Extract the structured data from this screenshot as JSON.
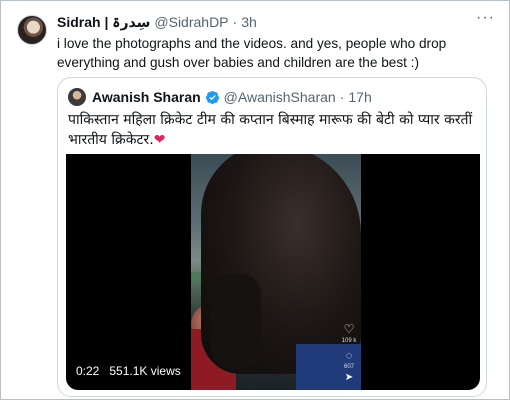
{
  "tweet": {
    "name": "Sidrah | سِدرۃ",
    "handle": "@SidrahDP",
    "time": "3h",
    "more_label": "···",
    "text": "i love the photographs and the videos. and yes, people who drop everything and gush over babies and children are the best :)"
  },
  "quote": {
    "name": "Awanish Sharan",
    "handle": "@AwanishSharan",
    "time": "17h",
    "text": "पाकिस्तान महिला क्रिकेट टीम की कप्तान बिस्माह मारूफ की बेटी को प्यार करतीं भारतीय क्रिकेटर.",
    "heart": "❤",
    "video": {
      "duration": "0:22",
      "views": "551.1K views",
      "stats": {
        "likes": "109 k",
        "comments": "607",
        "shares": ""
      }
    }
  },
  "colors": {
    "verified": "#1d9bf0",
    "muted_text": "#536471",
    "heart": "#e0245e"
  }
}
